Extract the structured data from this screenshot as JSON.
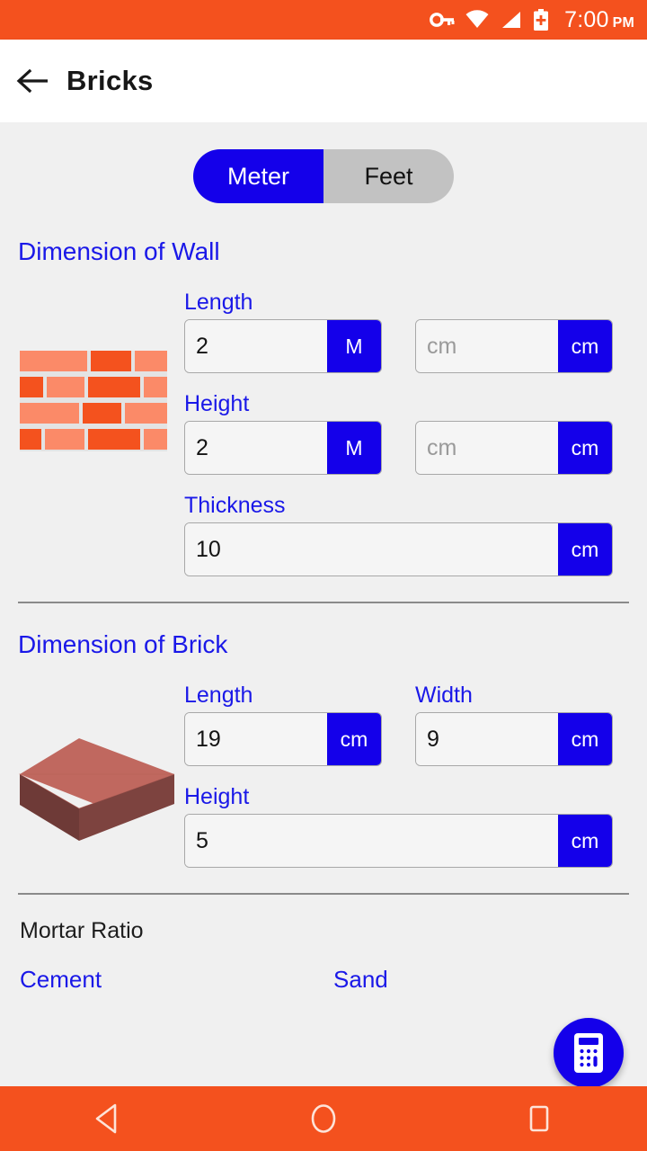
{
  "status_bar": {
    "time": "7:00",
    "ampm": "PM",
    "icons": [
      "vpn-key-icon",
      "wifi-icon",
      "signal-icon",
      "battery-charging-icon"
    ],
    "background_color": "#F4511E"
  },
  "app_bar": {
    "back_label": "back-arrow",
    "title": "Bricks"
  },
  "unit_toggle": {
    "options": [
      {
        "label": "Meter",
        "selected": true
      },
      {
        "label": "Feet",
        "selected": false
      }
    ],
    "active_color": "#1400EA",
    "inactive_color": "#C2C2C2"
  },
  "wall_section": {
    "title": "Dimension of Wall",
    "art": "brick-wall-icon",
    "fields": [
      {
        "label": "Length",
        "primary": {
          "value": "2",
          "unit": "M"
        },
        "secondary": {
          "value": "",
          "placeholder": "cm",
          "unit": "cm"
        }
      },
      {
        "label": "Height",
        "primary": {
          "value": "2",
          "unit": "M"
        },
        "secondary": {
          "value": "",
          "placeholder": "cm",
          "unit": "cm"
        }
      },
      {
        "label": "Thickness",
        "primary": {
          "value": "10",
          "unit": "cm"
        }
      }
    ]
  },
  "brick_section": {
    "title": "Dimension of Brick",
    "art": "brick-3d-icon",
    "fields": [
      {
        "label": "Length",
        "primary": {
          "value": "19",
          "unit": "cm"
        }
      },
      {
        "label": "Width",
        "primary": {
          "value": "9",
          "unit": "cm"
        }
      },
      {
        "label": "Height",
        "primary": {
          "value": "5",
          "unit": "cm"
        }
      }
    ]
  },
  "mortar_section": {
    "title": "Mortar Ratio",
    "cement_label": "Cement",
    "sand_label": "Sand"
  },
  "fab": {
    "icon": "calculator-icon",
    "color": "#1400EA"
  },
  "nav_bar": {
    "background_color": "#F4511E",
    "buttons": [
      "back-nav-button",
      "home-nav-button",
      "recents-nav-button"
    ]
  },
  "theme": {
    "accent_blue": "#1400EA",
    "label_blue": "#1A18E8",
    "orange": "#F4511E",
    "page_background": "#F0F0F0"
  }
}
